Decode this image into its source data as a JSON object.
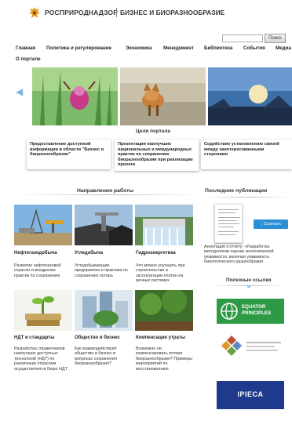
{
  "header": {
    "brand": "РОСПРИРОДНАДЗОР",
    "subtitle": "БИЗНЕС И БИОРАЗНООБРАЗИЕ"
  },
  "search": {
    "placeholder": "",
    "button": "Поиск"
  },
  "nav": [
    "Главная",
    "Политика и регулирование",
    "Экономика",
    "Менеджмент",
    "Библиотека",
    "События",
    "Медиа"
  ],
  "about": "О портале",
  "goals": {
    "title": "Цели портала",
    "cards": [
      "Предоставление доступной информации в области \"Бизнес и биоразнообразие\"",
      "Презентация наилучших национальных и международных практик по сохранению биоразнообразия при реализации проекта",
      "Содействие установлению связей между заинтересованными сторонами"
    ]
  },
  "directions": {
    "title": "Направления работы",
    "tiles": [
      {
        "title": "Нефтегазодобыча",
        "desc": "Развитие нефтегазовой отрасли и внедрение практик по сохранению"
      },
      {
        "title": "Угледобыча",
        "desc": "Угледобывающие предприятия и практики по сохранению потерь"
      },
      {
        "title": "Гидроэнергетика",
        "desc": "Что можно улучшить при строительстве и эксплуатации плотин на речных системах"
      },
      {
        "title": "НДТ и стандарты",
        "desc": "Разработка справочников наилучших доступных технологий (НДТ) по различным отраслям осуществляется Бюро НДТ"
      },
      {
        "title": "Общество и бизнес",
        "desc": "Как взаимодействуют общество и бизнес в вопросах сохранения биоразнообразия?"
      },
      {
        "title": "Компенсация утраты",
        "desc": "Возможно ли компенсировать потери биоразнообразия? Примеры мероприятий по восстановлению"
      }
    ]
  },
  "publications": {
    "title": "Последние публикации",
    "download": "Скачать",
    "annotation": "Аннотация к отчету: «Разработка методологии оценки экологической уязвимости, включая уязвимость биологического разнообразия"
  },
  "useful_links": {
    "title": "Полезные ссылки",
    "partners": [
      "EQUATOR PRINCIPLES",
      "IPIECA"
    ]
  },
  "colors": {
    "brand_gold": "#d9a21b",
    "accent_blue": "#2b8fd6",
    "equator_green": "#2f9a45",
    "ipieca_navy": "#1f3a8c"
  }
}
